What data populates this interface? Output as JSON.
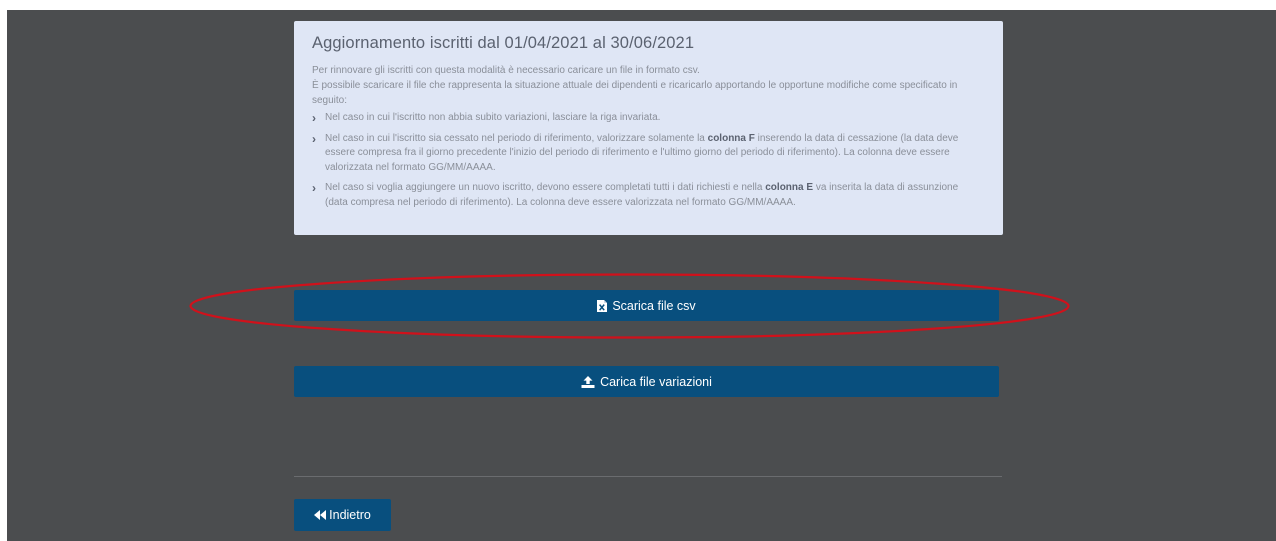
{
  "info_panel": {
    "title": "Aggiornamento iscritti dal 01/04/2021 al 30/06/2021",
    "intro_line_1": "Per rinnovare gli iscritti con questa modalità è necessario caricare un file in formato csv.",
    "intro_line_2": "È possibile scaricare il file che rappresenta la situazione attuale dei dipendenti e ricaricarlo apportando le opportune modifiche come specificato in seguito:",
    "rule_1": "Nel caso in cui l'iscritto non abbia subito variazioni, lasciare la riga invariata.",
    "rule_2_before": "Nel caso in cui l'iscritto sia cessato nel periodo di riferimento, valorizzare solamente la ",
    "rule_2_bold": "colonna F",
    "rule_2_after": " inserendo la data di cessazione (la data deve essere compresa fra il giorno precedente l'inizio del periodo di riferimento e l'ultimo giorno del periodo di riferimento). La colonna deve essere valorizzata nel formato GG/MM/AAAA.",
    "rule_3_before": "Nel caso si voglia aggiungere un nuovo iscritto, devono essere completati tutti i dati richiesti e nella ",
    "rule_3_bold": "colonna E",
    "rule_3_after": " va inserita la data di assunzione (data compresa nel periodo di riferimento). La colonna deve essere valorizzata nel formato GG/MM/AAAA.",
    "bullet_icon": "chevron-right-icon"
  },
  "actions": {
    "download_label": "Scarica file csv",
    "download_icon": "file-excel-icon",
    "upload_label": "Carica file variazioni",
    "upload_icon": "upload-icon",
    "back_label": "Indietro",
    "back_icon": "backward-icon"
  },
  "annotation": {
    "color": "#d0111b",
    "shape": "ellipse"
  },
  "colors": {
    "background": "#4b4d4f",
    "panel": "#dfe6f5",
    "button": "#084f7e"
  }
}
